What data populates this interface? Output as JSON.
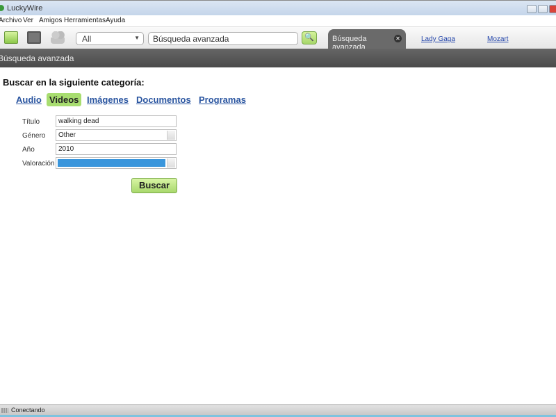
{
  "window": {
    "title": "LuckyWire"
  },
  "menu": [
    "Archivo",
    "Ver",
    "Amigos",
    "Herramientas",
    "Ayuda"
  ],
  "toolbar": {
    "filter_value": "All",
    "search_value": "Búsqueda avanzada"
  },
  "tabs": {
    "active": "Búsqueda avanzada",
    "links": [
      "Lady Gaga",
      "Mozart"
    ]
  },
  "section_title": "Búsqueda avanzada",
  "form": {
    "heading": "Buscar en la siguiente categoría:",
    "categories": [
      "Audio",
      "Videos",
      "Imágenes",
      "Documentos",
      "Programas"
    ],
    "active_category": "Videos",
    "fields": {
      "titulo": {
        "label": "Título",
        "value": "walking dead"
      },
      "genero": {
        "label": "Género",
        "value": "Other"
      },
      "anio": {
        "label": "Año",
        "value": "2010"
      },
      "valoracion": {
        "label": "Valoración",
        "value": ""
      }
    },
    "submit": "Buscar"
  },
  "status": "Conectando",
  "colors": {
    "accent": "#a8dd70",
    "dark_bar": "#555555",
    "link": "#2a55a0",
    "selection": "#3a96dc"
  }
}
